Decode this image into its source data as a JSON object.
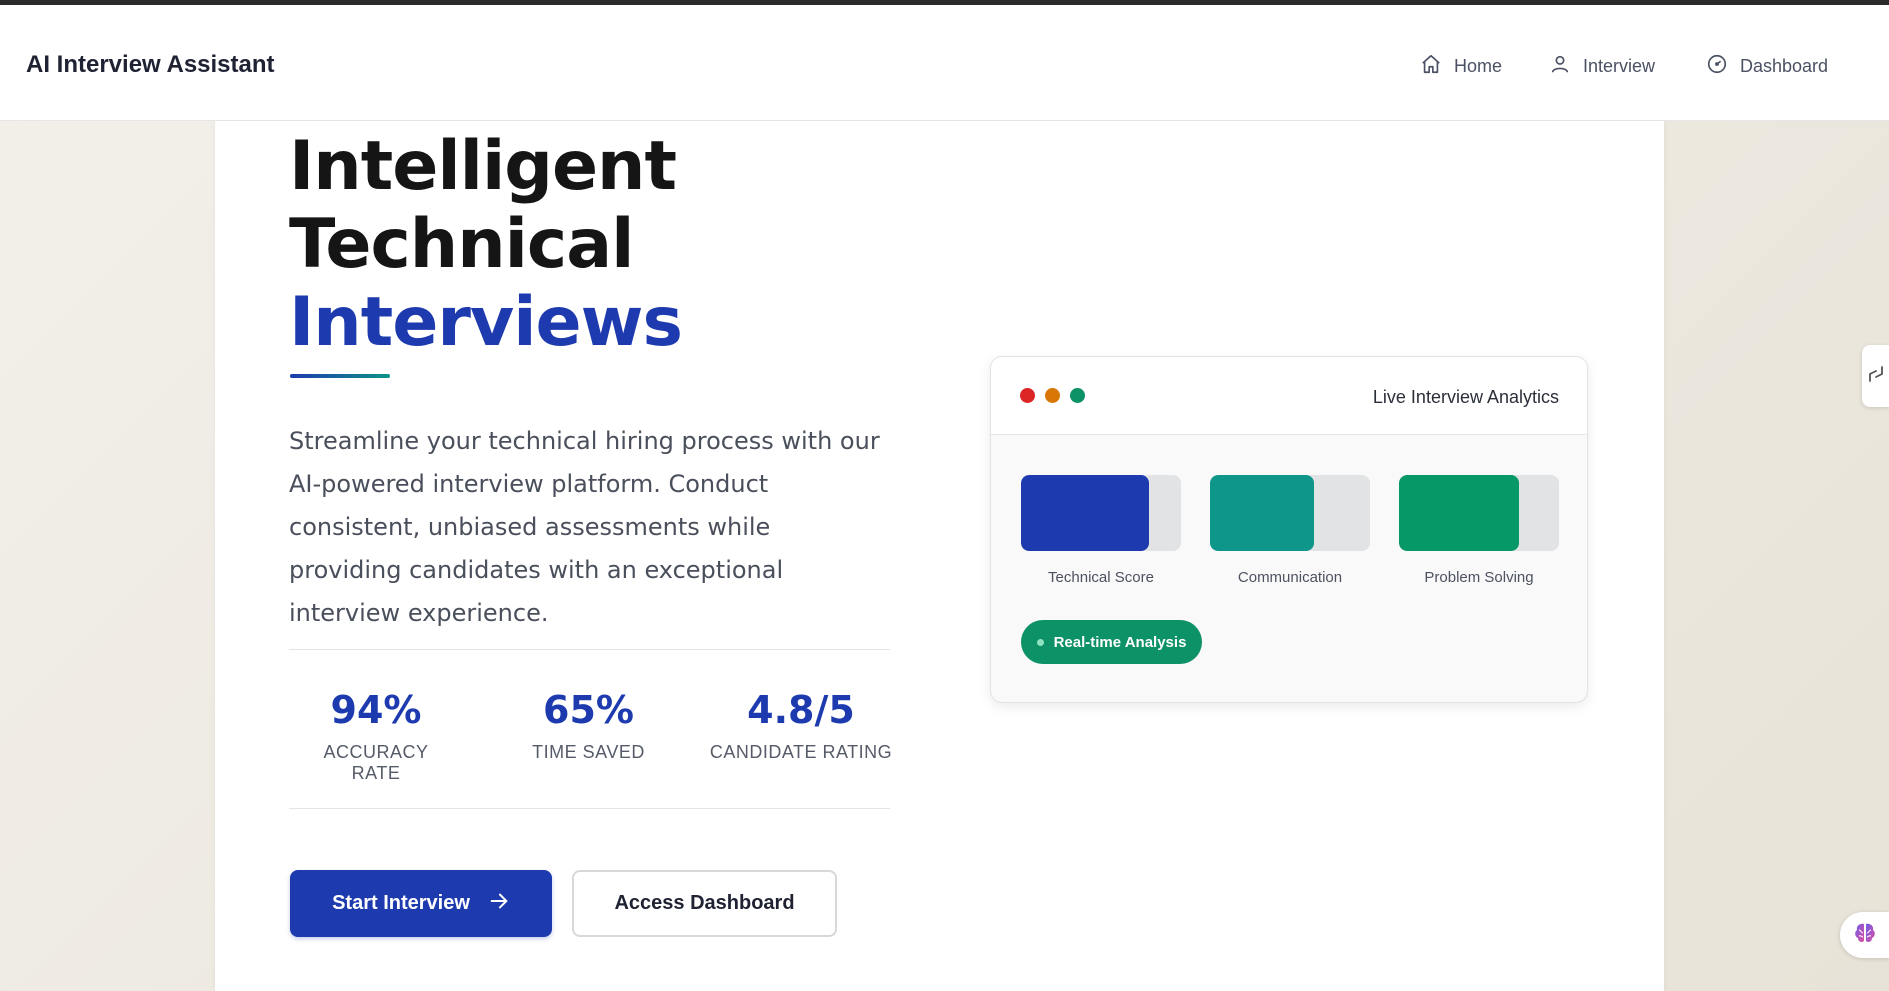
{
  "navbar": {
    "brand": "AI Interview Assistant",
    "items": [
      {
        "label": "Home",
        "icon": "home-icon"
      },
      {
        "label": "Interview",
        "icon": "user-icon"
      },
      {
        "label": "Dashboard",
        "icon": "gauge-icon"
      }
    ]
  },
  "hero": {
    "title_line1": "Intelligent",
    "title_line2": "Technical",
    "title_accent": "Interviews",
    "description": "Streamline your technical hiring process with our AI-powered interview platform. Conduct consistent, unbiased assessments while providing candidates with an exceptional interview experience."
  },
  "stats": [
    {
      "value": "94%",
      "label": "ACCURACY RATE"
    },
    {
      "value": "65%",
      "label": "TIME SAVED"
    },
    {
      "value": "4.8/5",
      "label": "CANDIDATE RATING"
    }
  ],
  "buttons": {
    "primary": "Start Interview",
    "secondary": "Access Dashboard"
  },
  "analytics": {
    "title": "Live Interview Analytics",
    "window_dots": [
      "#dc2626",
      "#d97706",
      "#0d9166"
    ],
    "metrics": [
      {
        "label": "Technical Score",
        "fill": 0.8,
        "color": "#1e3aaf"
      },
      {
        "label": "Communication",
        "fill": 0.65,
        "color": "#0f968a"
      },
      {
        "label": "Problem Solving",
        "fill": 0.75,
        "color": "#069866"
      }
    ],
    "badge": "Real-time Analysis"
  },
  "colors": {
    "accent": "#1e3aaf",
    "teal": "#0e9488",
    "green": "#0d9166"
  }
}
